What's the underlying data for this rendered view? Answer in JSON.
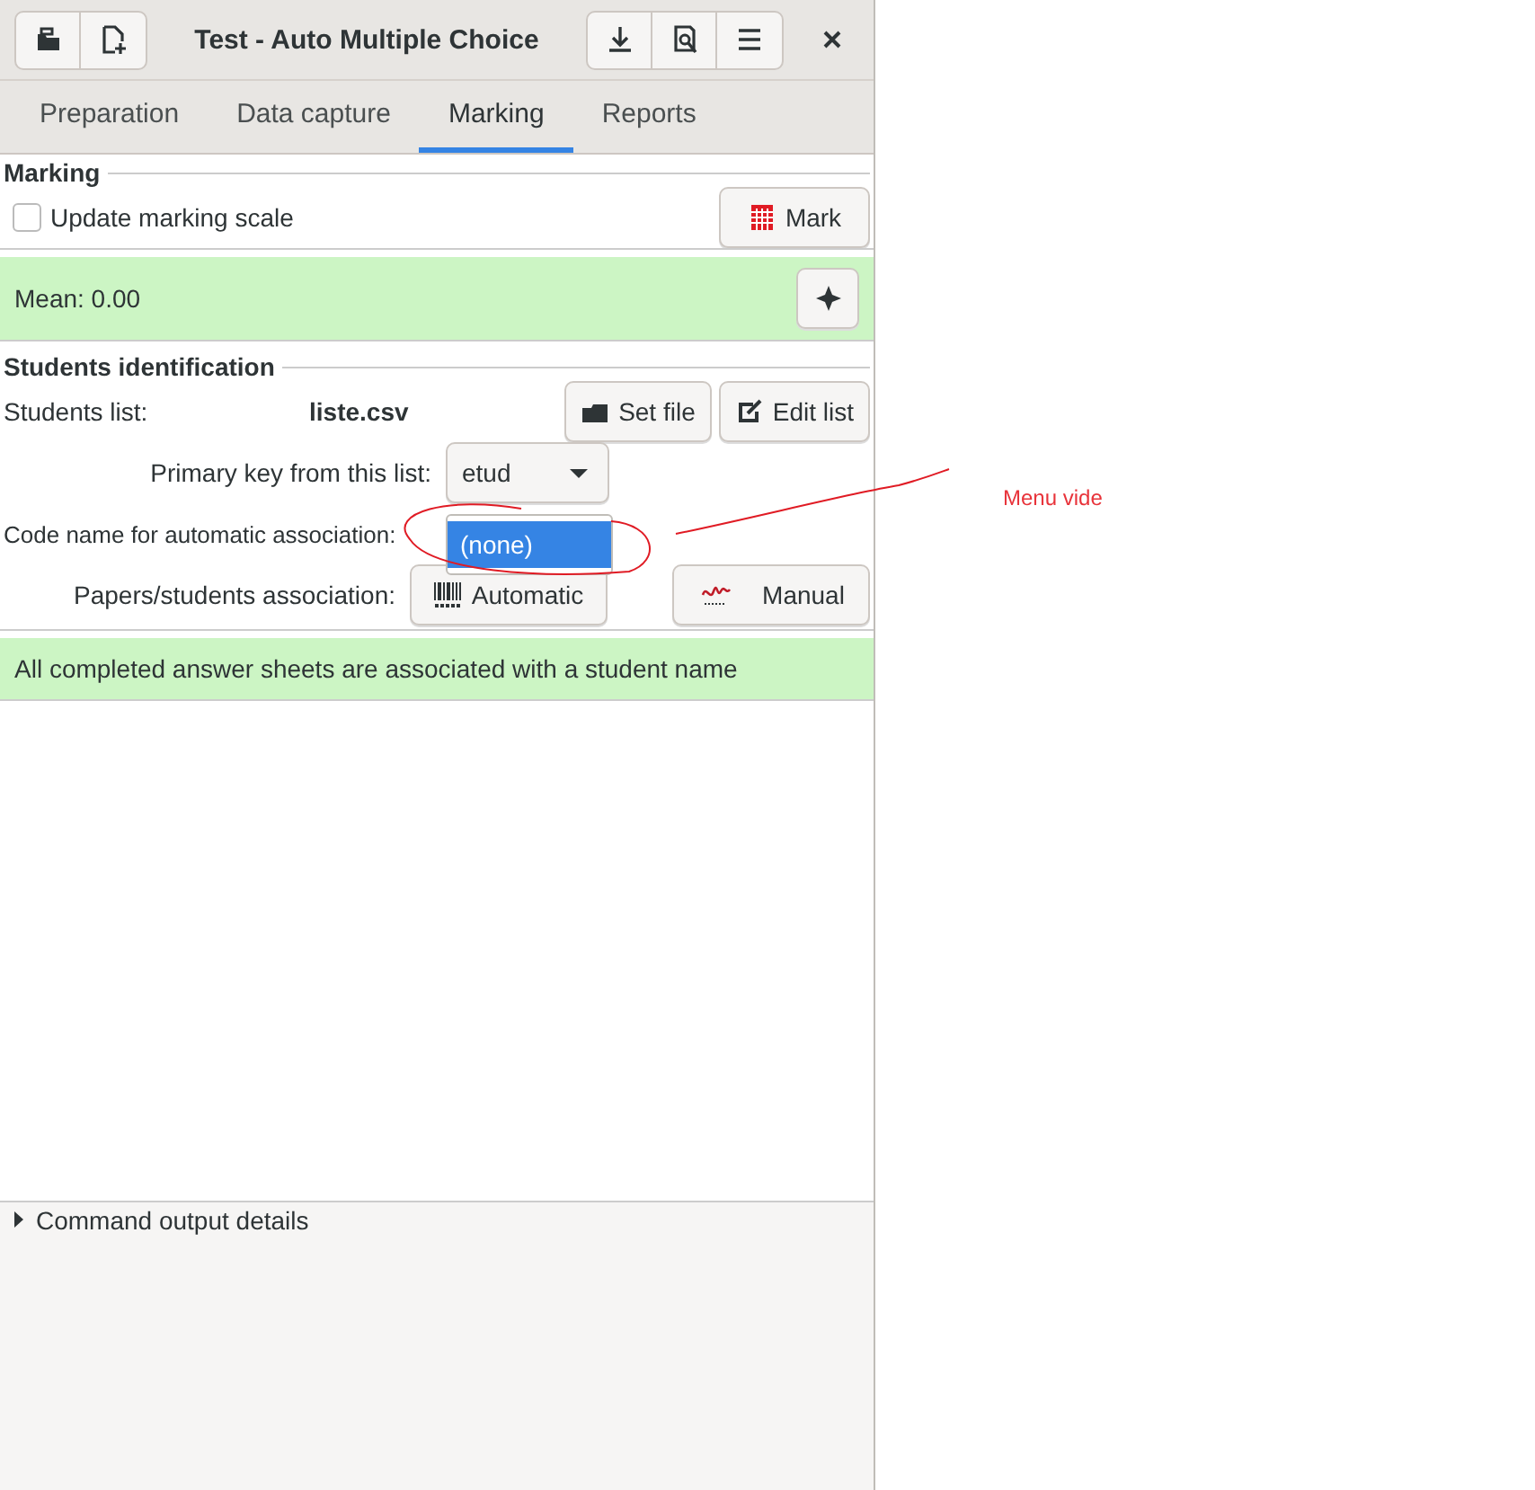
{
  "window": {
    "title": "Test - Auto Multiple Choice"
  },
  "tabs": [
    {
      "label": "Preparation",
      "selected": false
    },
    {
      "label": "Data capture",
      "selected": false
    },
    {
      "label": "Marking",
      "selected": true
    },
    {
      "label": "Reports",
      "selected": false
    }
  ],
  "marking": {
    "heading": "Marking",
    "update_scale": {
      "label": "Update marking scale",
      "checked": false
    },
    "mark_button": "Mark",
    "mean": "Mean: 0.00"
  },
  "students": {
    "heading": "Students identification",
    "list_label": "Students list:",
    "list_file": "liste.csv",
    "set_file_button": "Set file",
    "edit_list_button": "Edit list",
    "primary_key_label": "Primary key from this list:",
    "primary_key_value": "etud",
    "code_name_label": "Code name for automatic association:",
    "code_name_menu": [
      {
        "label": "(none)",
        "selected": true
      }
    ],
    "association_label": "Papers/students association:",
    "automatic_button": "Automatic",
    "manual_button": "Manual",
    "status": "All completed answer sheets are associated with a student name"
  },
  "command_output": {
    "label": "Command output details",
    "expanded": false
  },
  "annotation": {
    "text": "Menu vide"
  }
}
